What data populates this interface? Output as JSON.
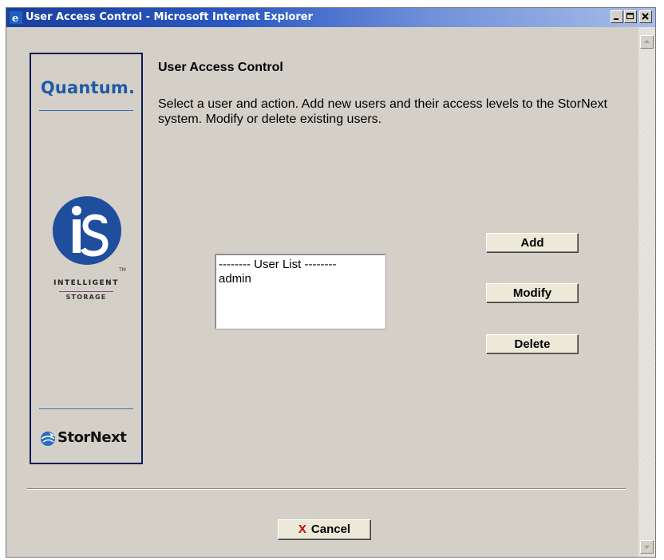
{
  "window": {
    "title": "User Access Control - Microsoft Internet Explorer"
  },
  "sidebar": {
    "brand": "Quantum.",
    "product_logo_text": "iS",
    "trademark": "TM",
    "tagline_line1": "INTELLIGENT",
    "tagline_line2": "STORAGE",
    "footer_brand": "StorNext"
  },
  "main": {
    "heading": "User Access Control",
    "description": "Select a user and action. Add new users and their access levels to the StorNext system. Modify or delete existing users."
  },
  "user_list": {
    "items": [
      "-------- User List --------",
      "admin"
    ]
  },
  "actions": {
    "add_label": "Add",
    "modify_label": "Modify",
    "delete_label": "Delete"
  },
  "footer": {
    "cancel_label": "Cancel",
    "cancel_icon": "X"
  },
  "colors": {
    "background": "#d4d0c8",
    "brand_blue": "#1e5aa8",
    "panel_border": "#0b1a55",
    "cancel_red": "#cc0000"
  },
  "icons": {
    "titlebar": "ie-icon",
    "minimize": "minimize-icon",
    "maximize": "maximize-icon",
    "close": "close-icon",
    "cancel": "x-icon"
  }
}
